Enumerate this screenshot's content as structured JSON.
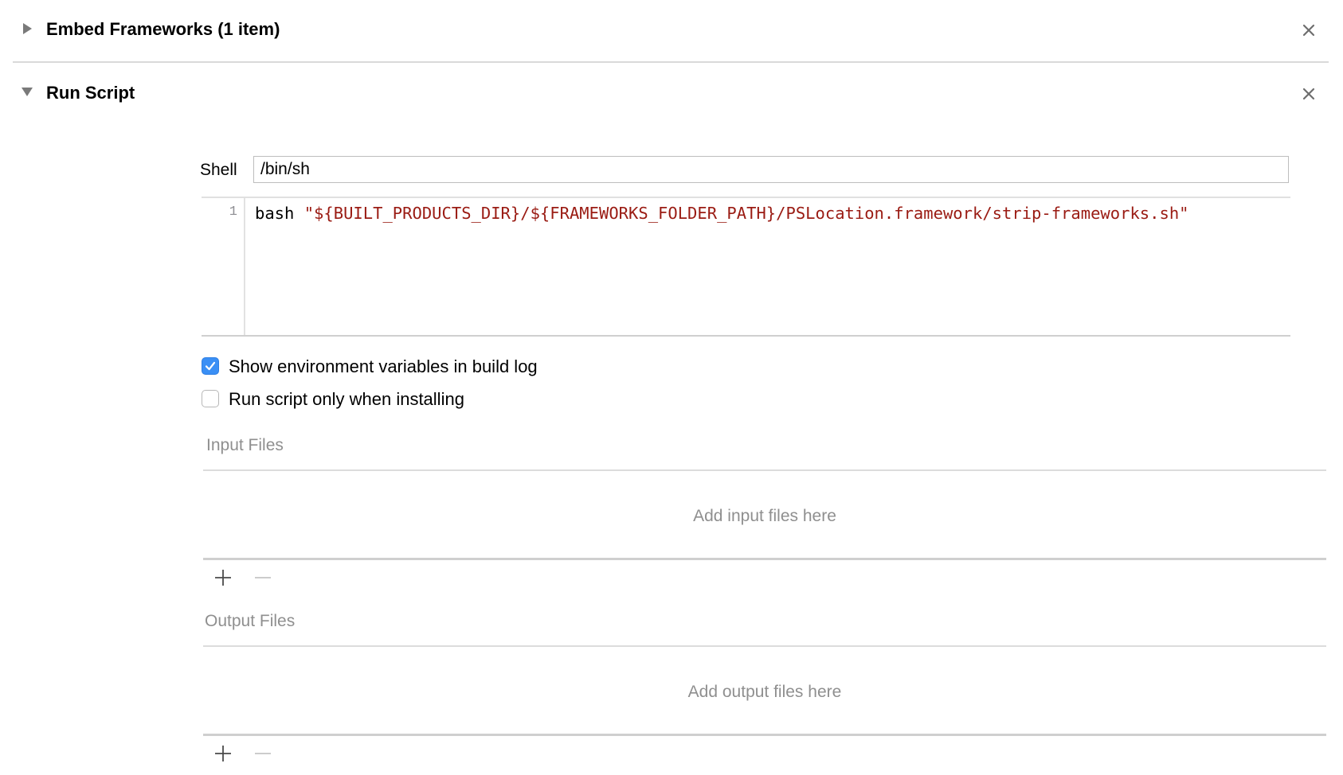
{
  "phases": {
    "embed_frameworks": {
      "title": "Embed Frameworks (1 item)",
      "expanded": false
    },
    "run_script": {
      "title": "Run Script",
      "expanded": true,
      "shell": {
        "label": "Shell",
        "value": "/bin/sh"
      },
      "script": {
        "line_number": "1",
        "command": "bash ",
        "argument": "\"${BUILT_PRODUCTS_DIR}/${FRAMEWORKS_FOLDER_PATH}/PSLocation.framework/strip-frameworks.sh\""
      },
      "options": {
        "show_env_vars": {
          "label": "Show environment variables in build log",
          "checked": true
        },
        "run_only_installing": {
          "label": "Run script only when installing",
          "checked": false
        }
      },
      "input_files": {
        "label": "Input Files",
        "placeholder": "Add input files here"
      },
      "output_files": {
        "label": "Output Files",
        "placeholder": "Add output files here"
      }
    }
  },
  "icons": {
    "collapsed": "disclosure-triangle-right-icon",
    "expanded": "disclosure-triangle-down-icon",
    "close": "close-x-icon",
    "add": "plus-icon",
    "remove": "minus-icon"
  },
  "colors": {
    "checkbox_accent": "#3a8ff5",
    "string_literal": "#9a1b13",
    "secondary_text": "#8f8f8f",
    "divider": "#d9d9d9"
  }
}
